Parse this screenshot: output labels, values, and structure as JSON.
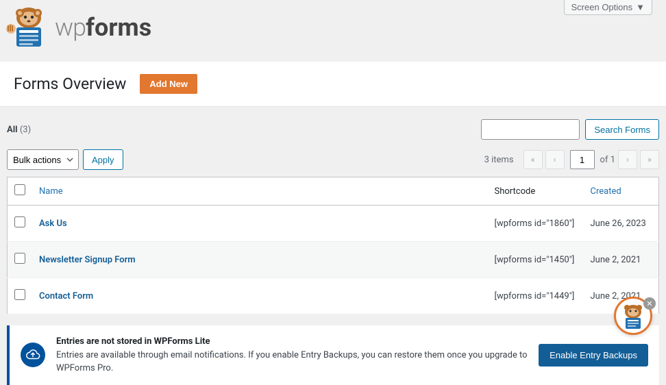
{
  "screen_options_label": "Screen Options",
  "logo": {
    "wp": "wp",
    "forms": "forms"
  },
  "page_title": "Forms Overview",
  "add_new_label": "Add New",
  "filter": {
    "all_label": "All",
    "all_count": "(3)"
  },
  "search": {
    "placeholder": "",
    "button_label": "Search Forms"
  },
  "bulk": {
    "selected": "Bulk actions",
    "apply_label": "Apply"
  },
  "pagination": {
    "count_text": "3 items",
    "first": "«",
    "prev": "‹",
    "next": "›",
    "last": "»",
    "current": "1",
    "of_text": "of 1"
  },
  "columns": {
    "name": "Name",
    "shortcode": "Shortcode",
    "created": "Created"
  },
  "rows": [
    {
      "name": "Ask Us",
      "shortcode": "[wpforms id=\"1860\"]",
      "created": "June 26, 2023"
    },
    {
      "name": "Newsletter Signup Form",
      "shortcode": "[wpforms id=\"1450\"]",
      "created": "June 2, 2021"
    },
    {
      "name": "Contact Form",
      "shortcode": "[wpforms id=\"1449\"]",
      "created": "June 2, 2021"
    }
  ],
  "notice": {
    "title": "Entries are not stored in WPForms Lite",
    "body": "Entries are available through email notifications. If you enable Entry Backups, you can restore them once you upgrade to WPForms Pro.",
    "button_label": "Enable Entry Backups"
  }
}
